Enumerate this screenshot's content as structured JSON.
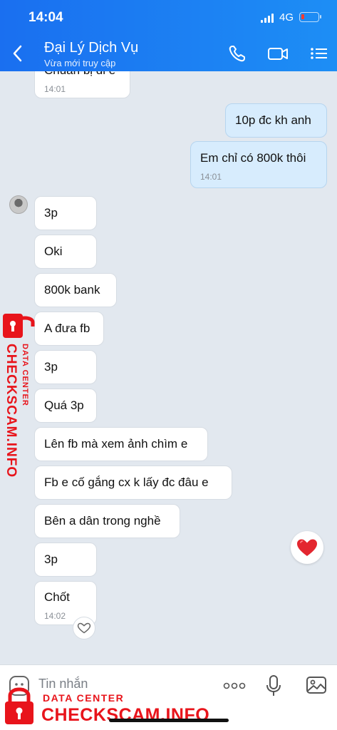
{
  "status_bar": {
    "time": "14:04",
    "network": "4G"
  },
  "header": {
    "title": "Đại Lý Dịch Vụ",
    "subtitle": "Vừa mới truy cập",
    "back_icon": "chevron-left-icon",
    "call_icon": "phone-icon",
    "video_icon": "video-camera-icon",
    "menu_icon": "list-menu-icon"
  },
  "messages": [
    {
      "dir": "in",
      "text": "Chuẩn bị đi e",
      "time": "14:01"
    },
    {
      "dir": "out",
      "text": "10p đc kh anh",
      "time": ""
    },
    {
      "dir": "out",
      "text": "Em chỉ có 800k thôi",
      "time": "14:01"
    },
    {
      "dir": "in",
      "text": "3p",
      "time": ""
    },
    {
      "dir": "in",
      "text": "Oki",
      "time": ""
    },
    {
      "dir": "in",
      "text": "800k bank",
      "time": ""
    },
    {
      "dir": "in",
      "text": "A đưa fb",
      "time": ""
    },
    {
      "dir": "in",
      "text": "3p",
      "time": ""
    },
    {
      "dir": "in",
      "text": "Quá 3p",
      "time": ""
    },
    {
      "dir": "in",
      "text": "Lên fb mà xem ảnh chìm e",
      "time": ""
    },
    {
      "dir": "in",
      "text": "Fb e cố gắng cx k lấy đc đâu e",
      "time": ""
    },
    {
      "dir": "in",
      "text": "Bên a dân trong nghề",
      "time": ""
    },
    {
      "dir": "in",
      "text": "3p",
      "time": ""
    },
    {
      "dir": "in",
      "text": "Chốt",
      "time": "14:02"
    }
  ],
  "input": {
    "placeholder": "Tin nhắn",
    "sticker_icon": "emoji-face-icon",
    "more_icon": "more-dots-icon",
    "mic_icon": "microphone-icon",
    "image_icon": "image-icon"
  },
  "watermark": {
    "small_label": "DATA CENTER",
    "big_label": "CHECKSCAM.INFO",
    "color": "#e8141b",
    "icon": "padlock-icon"
  },
  "colors": {
    "header_blue": "#1a7ff3",
    "outgoing_bubble": "#d7ecfd",
    "incoming_bubble": "#ffffff",
    "chat_bg": "#e2e8ef"
  }
}
